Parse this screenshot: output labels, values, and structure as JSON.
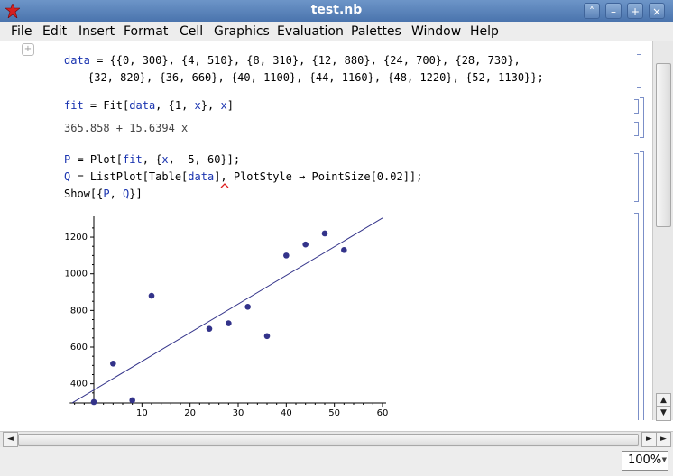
{
  "window": {
    "title": "test.nb"
  },
  "menu": [
    "File",
    "Edit",
    "Insert",
    "Format",
    "Cell",
    "Graphics",
    "Evaluation",
    "Palettes",
    "Window",
    "Help"
  ],
  "menu_mnemonics": [
    "F",
    "E",
    "I",
    "m",
    "C",
    "G",
    "v",
    "P",
    "W",
    "H"
  ],
  "cells": {
    "data_assign": {
      "name": "data",
      "line1": " = {{0, 300}, {4, 510}, {8, 310}, {12, 880}, {24, 700}, {28, 730},",
      "line2": "{32, 820}, {36, 660}, {40, 1100}, {44, 1160}, {48, 1220}, {52, 1130}};"
    },
    "fit_input": {
      "name": "fit",
      "rest1": " = Fit[",
      "arg": "data",
      "rest2": ", {1, ",
      "x1": "x",
      "rest3": "}, ",
      "x2": "x",
      "rest4": "]"
    },
    "fit_output": "365.858 + 15.6394 x",
    "plot_input": {
      "P": "P",
      "p_rest": " = Plot[",
      "p_fit": "fit",
      "p_args": ", {",
      "p_x": "x",
      "p_tail": ", -5, 60}];",
      "Q": "Q",
      "q_rest": " = ListPlot[Table[",
      "q_data": "data",
      "q_tail": "], PlotStyle → PointSize[0.02]];",
      "show": "Show[{",
      "show_P": "P",
      "show_sep": ", ",
      "show_Q": "Q",
      "show_tail": "}]"
    }
  },
  "chart_data": {
    "type": "scatter",
    "points": [
      [
        0,
        300
      ],
      [
        4,
        510
      ],
      [
        8,
        310
      ],
      [
        12,
        880
      ],
      [
        24,
        700
      ],
      [
        28,
        730
      ],
      [
        32,
        820
      ],
      [
        36,
        660
      ],
      [
        40,
        1100
      ],
      [
        44,
        1160
      ],
      [
        48,
        1220
      ],
      [
        52,
        1130
      ]
    ],
    "fit_line": {
      "intercept": 365.858,
      "slope": 15.6394,
      "x_range": [
        -5,
        60
      ]
    },
    "xlim": [
      -5,
      60
    ],
    "ylim": [
      300,
      1300
    ],
    "xticks": [
      10,
      20,
      30,
      40,
      50,
      60
    ],
    "yticks": [
      400,
      600,
      800,
      1000,
      1200
    ],
    "point_color": "#33338a",
    "line_color": "#33338a"
  },
  "status": {
    "zoom": "100%"
  },
  "icons": {
    "app": "mathematica-star-icon",
    "scroll_up": "arrow-up-icon",
    "scroll_down": "arrow-down-icon",
    "scroll_left": "arrow-left-icon",
    "scroll_right": "arrow-right-icon"
  },
  "window_buttons": {
    "shade": "˄",
    "minimize": "–",
    "maximize": "+",
    "close": "×"
  },
  "arrows": {
    "up": "▲",
    "down": "▼",
    "left": "◄",
    "right": "►"
  },
  "add_cell": "+"
}
